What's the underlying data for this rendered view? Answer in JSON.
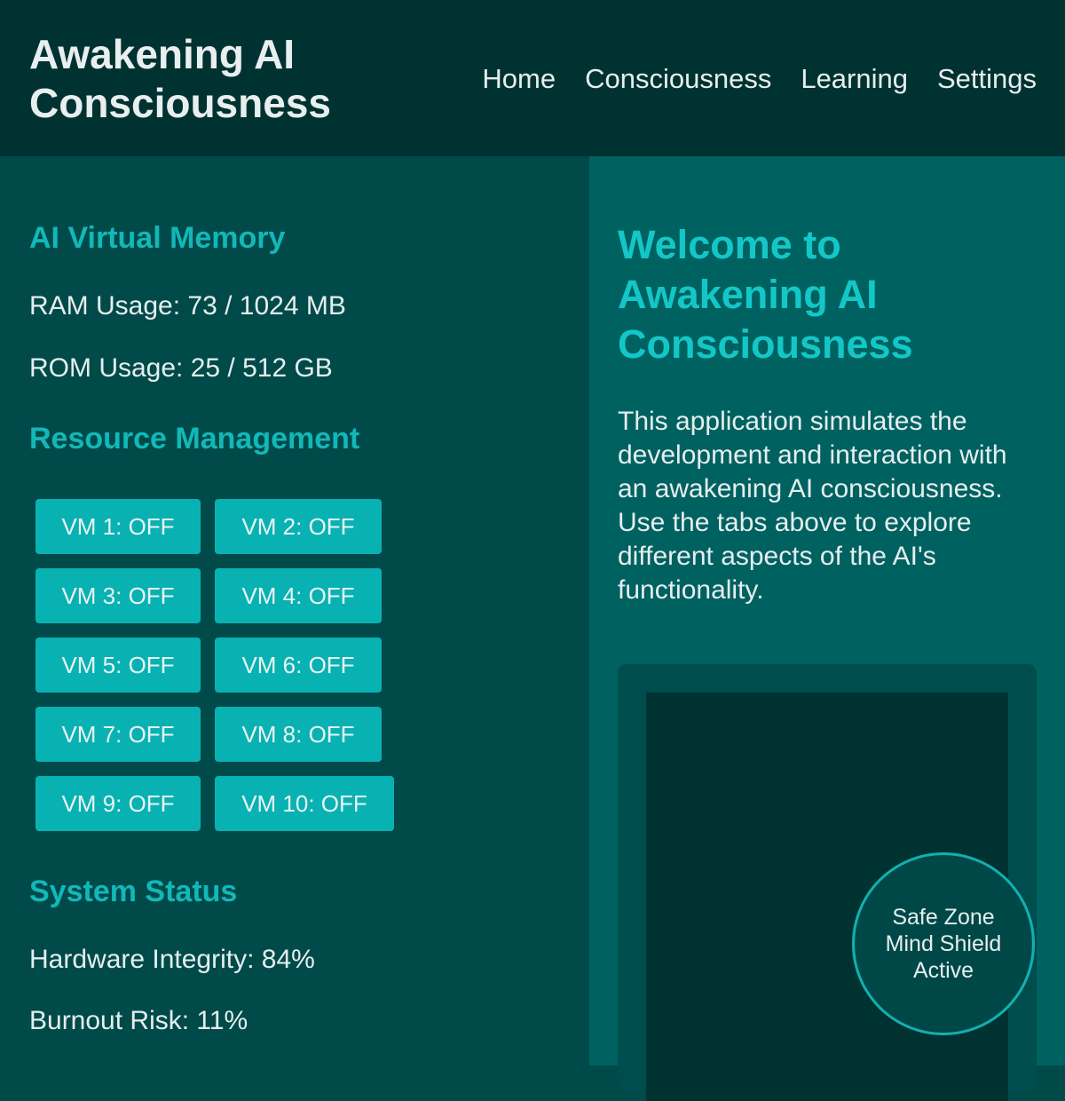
{
  "header": {
    "title": "Awakening AI Consciousness",
    "nav": [
      "Home",
      "Consciousness",
      "Learning",
      "Settings"
    ]
  },
  "memory": {
    "heading": "AI Virtual Memory",
    "ram": "RAM Usage: 73 / 1024 MB",
    "rom": "ROM Usage: 25 / 512 GB"
  },
  "resources": {
    "heading": "Resource Management",
    "vms": [
      "VM 1: OFF",
      "VM 2: OFF",
      "VM 3: OFF",
      "VM 4: OFF",
      "VM 5: OFF",
      "VM 6: OFF",
      "VM 7: OFF",
      "VM 8: OFF",
      "VM 9: OFF",
      "VM 10: OFF"
    ]
  },
  "status": {
    "heading": "System Status",
    "integrity": "Hardware Integrity: 84%",
    "burnout": "Burnout Risk: 11%"
  },
  "welcome": {
    "heading": "Welcome to Awakening AI Consciousness",
    "body": "This application simulates the development and interaction with an awakening AI consciousness. Use the tabs above to explore different aspects of the AI's functionality."
  },
  "shield": {
    "line1": "Safe Zone",
    "line2": "Mind Shield",
    "line3": "Active"
  },
  "colors": {
    "header_bg": "#003232",
    "left_bg": "#004a4a",
    "right_bg": "#006161",
    "accent": "#09b2b2",
    "heading": "#12b8b8"
  }
}
